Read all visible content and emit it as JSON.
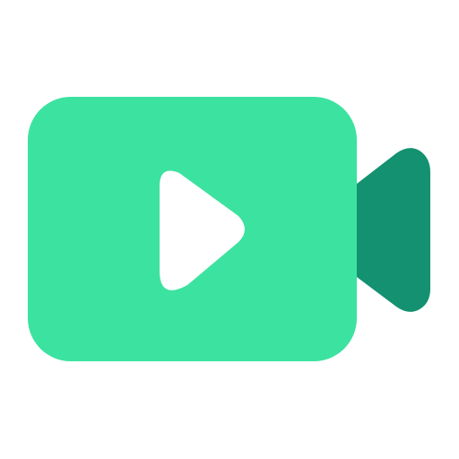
{
  "icon": {
    "name": "video-camera-icon",
    "colors": {
      "body": "#3CE2A0",
      "lens": "#139170",
      "play": "#FFFFFF",
      "background": "#FFFFFF"
    }
  }
}
